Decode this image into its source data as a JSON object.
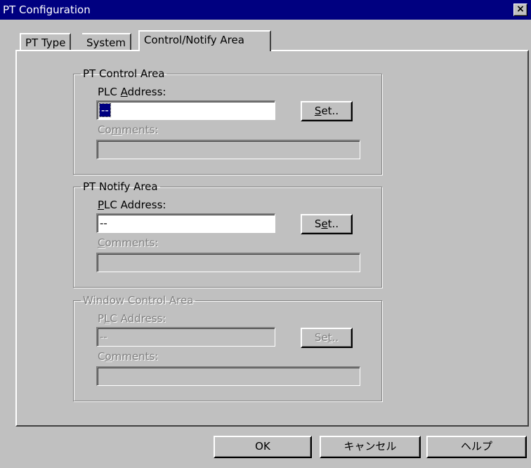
{
  "window": {
    "title": "PT Configuration",
    "close_glyph": "×"
  },
  "tabs": [
    {
      "label": "PT Type"
    },
    {
      "label": "System"
    },
    {
      "label": "Control/Notify Area"
    }
  ],
  "groups": {
    "control": {
      "title": "PT Control Area",
      "plc_label_pre": "PLC ",
      "plc_label_key": "A",
      "plc_label_post": "ddress:",
      "plc_value": "--",
      "set_key": "S",
      "set_post": "et..",
      "comments_pre": "Co",
      "comments_key": "m",
      "comments_post": "ments:",
      "comments_value": ""
    },
    "notify": {
      "title": "PT Notify Area",
      "plc_label_key": "P",
      "plc_label_post": "LC Address:",
      "plc_value": "--",
      "set_pre": "S",
      "set_key": "e",
      "set_post": "t..",
      "comments_key": "C",
      "comments_post": "omments:",
      "comments_value": ""
    },
    "window": {
      "title": "Window Control Area",
      "plc_label_pre": "P",
      "plc_label_key": "L",
      "plc_label_post": "C Address:",
      "plc_value": "--",
      "set_pre": "Se",
      "set_key": "t",
      "set_post": "..",
      "comments_pre": "C",
      "comments_key": "o",
      "comments_post": "mments:",
      "comments_value": ""
    }
  },
  "buttons": {
    "ok": "OK",
    "cancel": "キャンセル",
    "help": "ヘルプ"
  },
  "colors": {
    "titlebar": "#000080",
    "face": "#c0c0c0",
    "selection": "#000080"
  }
}
